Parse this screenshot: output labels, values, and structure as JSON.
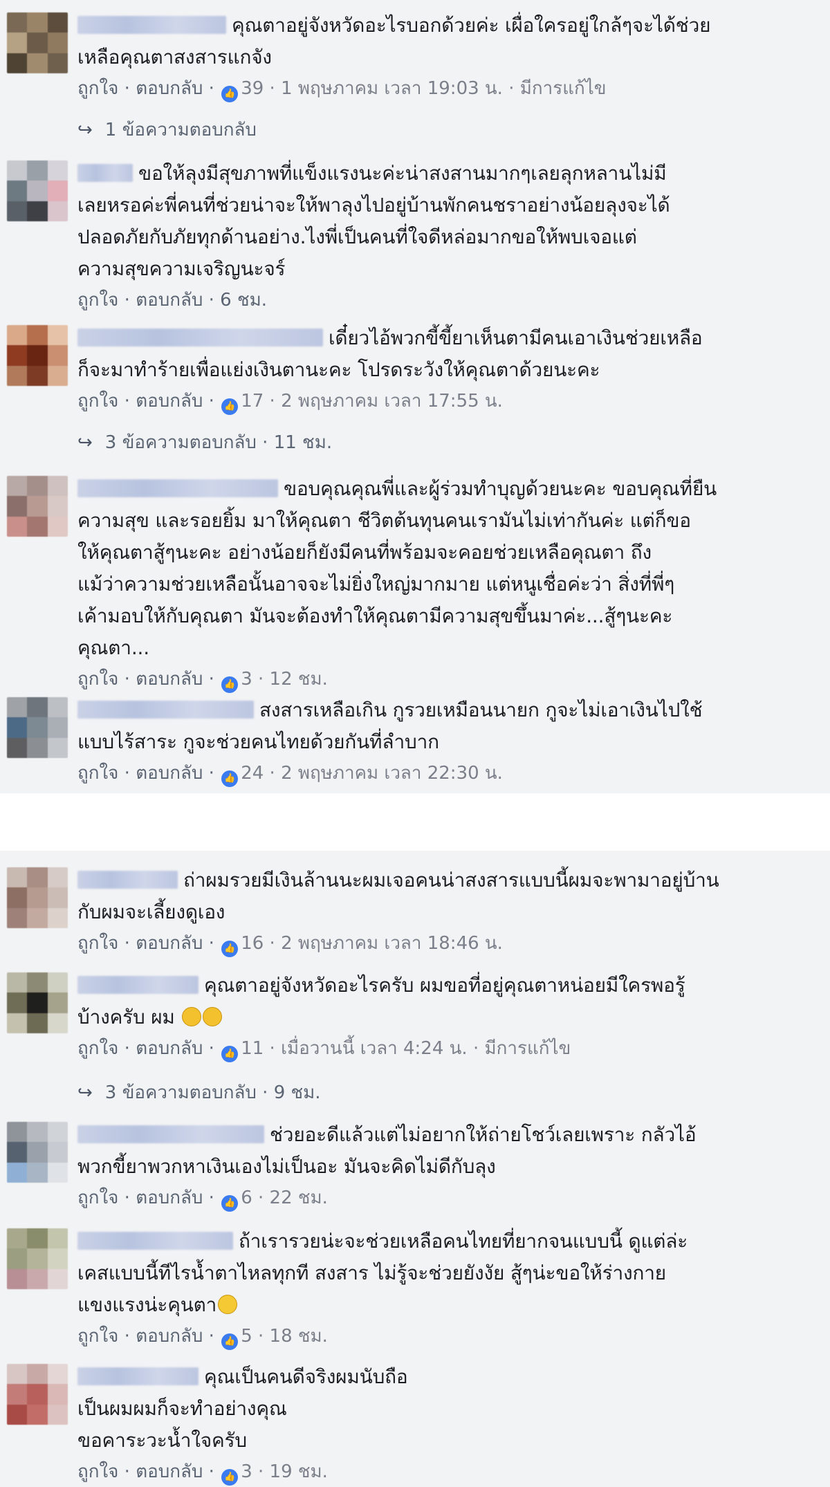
{
  "section1": {
    "comments": [
      {
        "lines": [
          "คุณตาอยู่จังหวัดอะไรบอกด้วยค่ะ เผื่อใครอยู่ใกล้ๆจะได้ช่วย",
          "เหลือคุณตาสงสารแกจัง"
        ],
        "actions": "ถูกใจ · ตอบกลับ ·",
        "likes": "39",
        "time": " · 1 พฤษภาคม เวลา 19:03 น. · มีการแก้ไข",
        "replies": "1 ข้อความตอบกลับ"
      },
      {
        "lines": [
          "ขอให้ลุงมีสุขภาพที่แข็งแรงนะค่ะน่าสงสานมากๆเลยลุกหลานไม่มี",
          "เลยหรอค่ะพี่คนที่ช่วยน่าจะให้พาลุงไปอยู่บ้านพักคนชราอย่างน้อยลุงจะได้",
          "ปลอดภัยกับภัยทุกด้านอย่าง.ไงพี่เป็นคนที่ใจดีหล่อมากขอให้พบเจอแต่",
          "ความสุขความเจริญนะจร์"
        ],
        "actions": "ถูกใจ · ตอบกลับ · 6 ชม."
      },
      {
        "lines": [
          "เดี๋ยวไอ้พวกขี้ขี้ยาเห็นตามีคนเอาเงินช่วยเหลือ",
          "ก็จะมาทำร้ายเพื่อแย่งเงินตานะคะ โปรดระวังให้คุณตาด้วยนะคะ"
        ],
        "actions": "ถูกใจ · ตอบกลับ ·",
        "likes": "17",
        "time": " · 2 พฤษภาคม เวลา 17:55 น.",
        "replies": "3 ข้อความตอบกลับ · 11 ชม."
      },
      {
        "lines": [
          "ขอบคุณคุณพี่และผู้ร่วมทำบุญด้วยนะคะ ขอบคุณที่ยืน",
          "ความสุข และรอยยิ้ม มาให้คุณตา ชีวิตต้นทุนคนเรามันไม่เท่ากันค่ะ แต่ก็ขอ",
          "ให้คุณตาสู้ๆนะคะ อย่างน้อยก็ยังมีคนที่พร้อมจะคอยช่วยเหลือคุณตา ถึง",
          "แม้ว่าความช่วยเหลือนั้นอาจจะไม่ยิ่งใหญ่มากมาย แต่หนูเชื่อค่ะว่า สิ่งที่พี่ๆ",
          "เค้ามอบให้กับคุณตา มันจะต้องทำให้คุณตามีความสุขขึ้นมาค่ะ...สู้ๆนะคะ",
          "คุณตา..."
        ],
        "actions": "ถูกใจ · ตอบกลับ ·",
        "likes": "3",
        "time": " · 12 ชม."
      },
      {
        "lines": [
          "สงสารเหลือเกิน กูรวยเหมือนนายก กูจะไม่เอาเงินไปใช้",
          "แบบไร้สาระ กูจะช่วยคนไทยด้วยกันที่ลำบาก"
        ],
        "actions": "ถูกใจ · ตอบกลับ ·",
        "likes": "24",
        "time": " · 2 พฤษภาคม เวลา 22:30 น."
      }
    ]
  },
  "section2": {
    "comments": [
      {
        "lines": [
          "ถ่าผมรวยมีเงินล้านนะผมเจอคนน่าสงสารแบบนี้ผมจะพามาอยู่บ้าน",
          "กับผมจะเลี้ยงดูเอง"
        ],
        "actions": "ถูกใจ · ตอบกลับ ·",
        "likes": "16",
        "time": " · 2 พฤษภาคม เวลา 18:46 น."
      },
      {
        "lines": [
          "คุณตาอยู่จังหวัดอะไรครับ ผมขอที่อยู่คุณตาหน่อยมีใครพอรู้",
          "บ้างครับ ผม"
        ],
        "actions": "ถูกใจ · ตอบกลับ ·",
        "likes": "11",
        "time": " · เมื่อวานนี้ เวลา 4:24 น. · มีการแก้ไข",
        "replies": "3 ข้อความตอบกลับ · 9 ชม."
      },
      {
        "lines": [
          "ช่วยอะดีแล้วแต่ไม่อยากให้ถ่ายโชว์เลยเพราะ กลัวไอ้",
          "พวกขี้ยาพวกหาเงินเองไม่เป็นอะ มันจะคิดไม่ดีกับลุง"
        ],
        "actions": "ถูกใจ · ตอบกลับ ·",
        "likes": "6",
        "time": " · 22 ชม."
      },
      {
        "lines": [
          "ถ้าเรารวยน่ะจะช่วยเหลือคนไทยที่ยากจนแบบนี้ ดูแต่ล่ะ",
          "เคสแบบนี้ทีไรน้ำตาไหลทุกที สงสาร ไม่รู้จะช่วยยังงัย สู้ๆน่ะขอให้ร่างกาย",
          "แขงแรงน่ะคุนตา"
        ],
        "actions": "ถูกใจ · ตอบกลับ ·",
        "likes": "5",
        "time": " · 18 ชม."
      },
      {
        "lines": [
          "คุณเป็นคนดีจริงผมนับถือ",
          "เป็นผมผมก็จะทำอย่างคุณ",
          "ขอคาระวะน้ำใจครับ"
        ],
        "actions": "ถูกใจ · ตอบกลับ ·",
        "likes": "3",
        "time": " · 19 ชม."
      }
    ]
  },
  "icons": {
    "like": "like-thumb-icon",
    "reply_arrow": "reply-arrow-icon"
  },
  "colors": {
    "panel": "#f2f3f5",
    "like_badge": "#3b7bf0",
    "meta": "#7a7f89"
  }
}
